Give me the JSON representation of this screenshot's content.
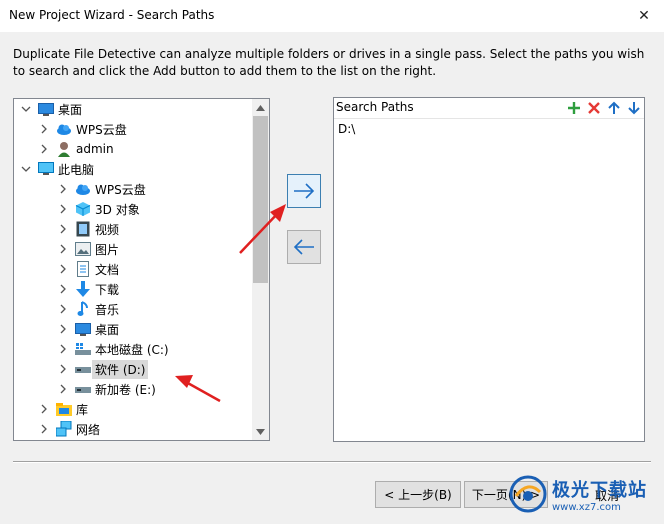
{
  "window": {
    "title": "New Project Wizard - Search Paths",
    "close_glyph": "✕"
  },
  "description": "Duplicate File Detective can analyze multiple folders or drives in a single pass. Select the paths you wish to search and click the Add button to add them to the list on the right.",
  "tree": {
    "items": [
      {
        "label": "桌面",
        "icon": "desktop-icon",
        "expanded": true
      },
      {
        "label": "WPS云盘",
        "icon": "cloud-icon"
      },
      {
        "label": "admin",
        "icon": "user-icon"
      },
      {
        "label": "此电脑",
        "icon": "computer-icon",
        "expanded": true
      },
      {
        "label": "WPS云盘",
        "icon": "cloud-icon"
      },
      {
        "label": "3D 对象",
        "icon": "cube-icon"
      },
      {
        "label": "视频",
        "icon": "video-icon"
      },
      {
        "label": "图片",
        "icon": "picture-icon"
      },
      {
        "label": "文档",
        "icon": "document-icon"
      },
      {
        "label": "下载",
        "icon": "download-icon"
      },
      {
        "label": "音乐",
        "icon": "music-icon"
      },
      {
        "label": "桌面",
        "icon": "desktop-icon"
      },
      {
        "label": "本地磁盘 (C:)",
        "icon": "windows-drive-icon"
      },
      {
        "label": "软件 (D:)",
        "icon": "drive-icon",
        "selected": true
      },
      {
        "label": "新加卷 (E:)",
        "icon": "drive-icon"
      },
      {
        "label": "库",
        "icon": "library-icon"
      },
      {
        "label": "网络",
        "icon": "network-icon"
      }
    ]
  },
  "paths_panel": {
    "header": "Search Paths",
    "items": [
      "D:\\"
    ],
    "tools": [
      "add-icon",
      "remove-icon",
      "move-up-icon",
      "move-down-icon"
    ]
  },
  "buttons": {
    "back": "< 上一步(B)",
    "next": "下一页(N) >",
    "cancel": "取消"
  },
  "watermark": {
    "text": "极光下载站",
    "url": "www.xz7.com"
  },
  "colors": {
    "accent_blue": "#3c7fb1",
    "annotation_red": "#e02020",
    "add_green": "#2e9e3e",
    "remove_red": "#e53935",
    "arrow_blue": "#1f6fc5"
  }
}
